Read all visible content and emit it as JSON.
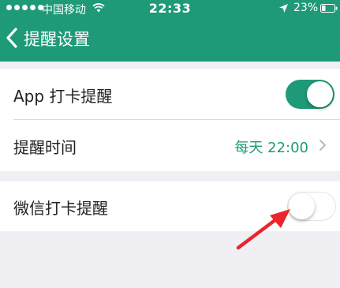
{
  "status_bar": {
    "carrier": "中国移动",
    "time": "22:33",
    "battery": "23%",
    "icons": [
      "signal-dots",
      "wifi-icon",
      "location-arrow-icon",
      "battery-icon"
    ]
  },
  "nav": {
    "title": "提醒设置",
    "back_icon": "chevron-left-icon"
  },
  "settings": {
    "app_checkin_reminder": {
      "label": "App 打卡提醒",
      "enabled": true
    },
    "reminder_time": {
      "label": "提醒时间",
      "value": "每天 22:00"
    },
    "wechat_checkin_reminder": {
      "label": "微信打卡提醒",
      "enabled": false
    }
  },
  "colors": {
    "accent": "#1e9a78",
    "background": "#efeff4",
    "annotation_arrow": "#e8262b"
  }
}
